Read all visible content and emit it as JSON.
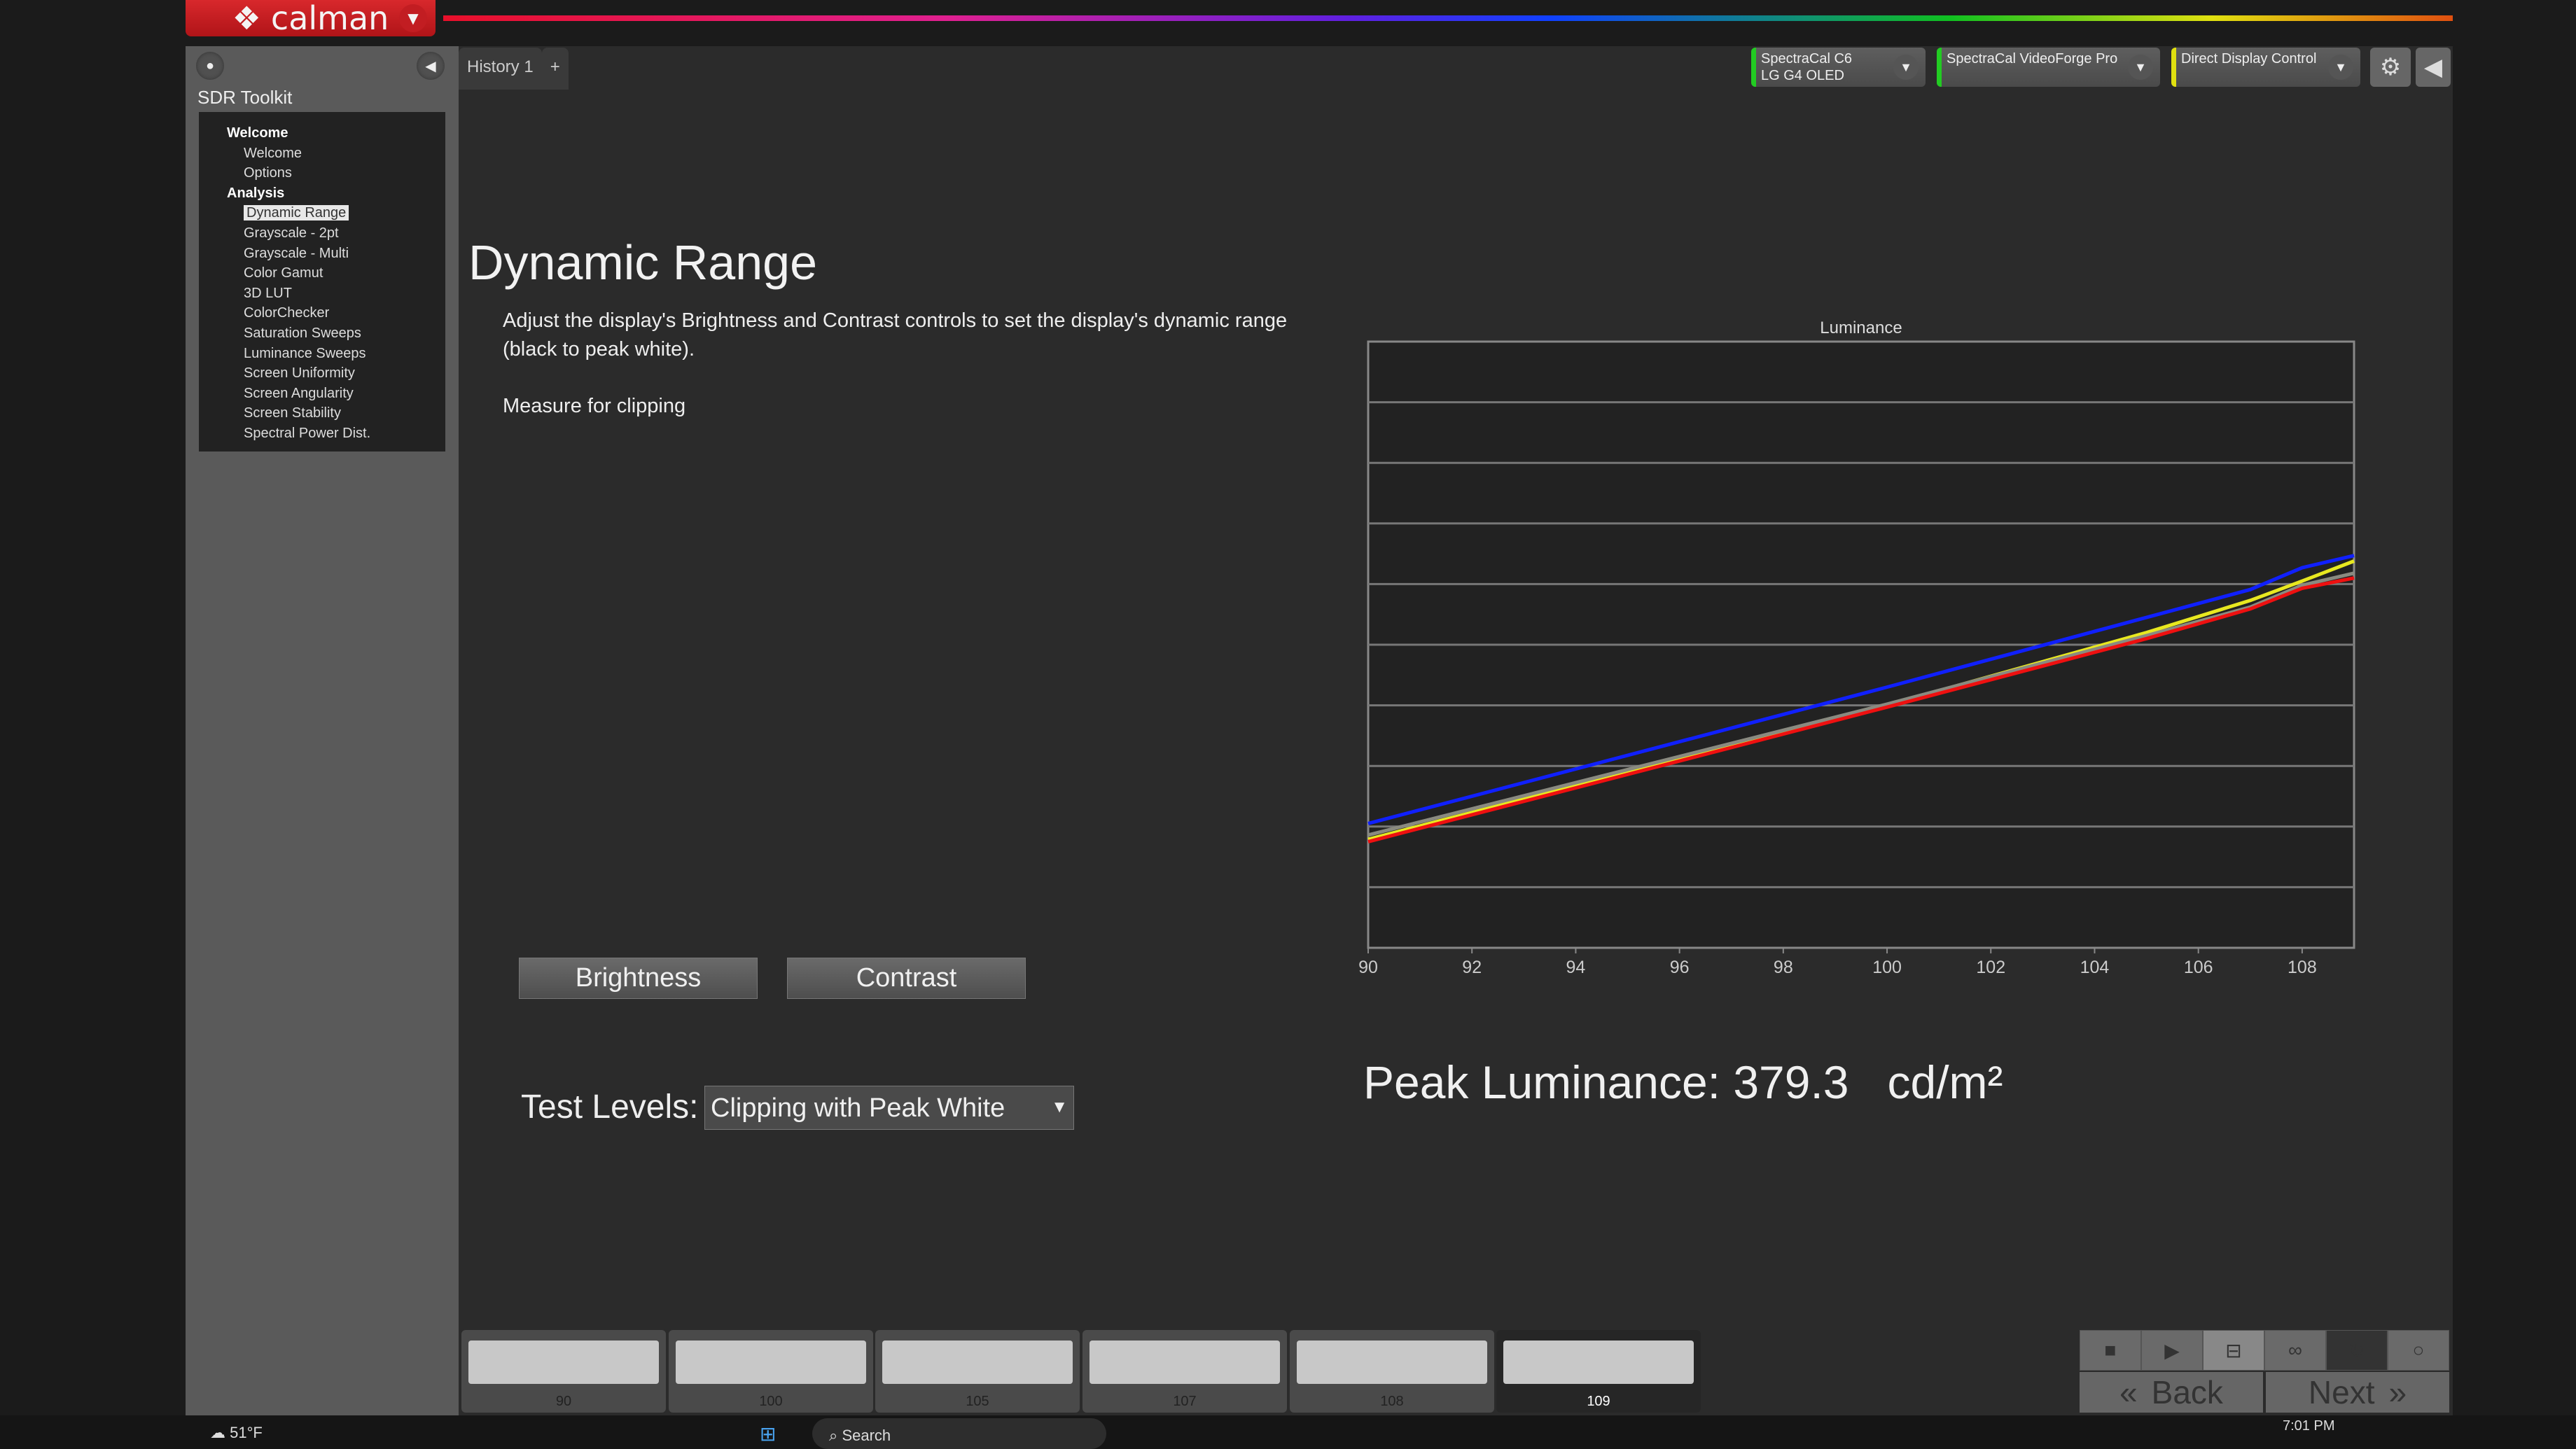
{
  "app": {
    "logo": "calman",
    "logo_icon": "calman-diamond-icon"
  },
  "sidebar": {
    "title": "SDR Toolkit",
    "tree": [
      {
        "label": "Welcome",
        "type": "group"
      },
      {
        "label": "Welcome",
        "type": "item"
      },
      {
        "label": "Options",
        "type": "item"
      },
      {
        "label": "Analysis",
        "type": "group"
      },
      {
        "label": "Dynamic Range",
        "type": "item",
        "selected": true
      },
      {
        "label": "Grayscale - 2pt",
        "type": "item"
      },
      {
        "label": "Grayscale - Multi",
        "type": "item"
      },
      {
        "label": "Color Gamut",
        "type": "item"
      },
      {
        "label": "3D LUT",
        "type": "item"
      },
      {
        "label": "ColorChecker",
        "type": "item"
      },
      {
        "label": "Saturation Sweeps",
        "type": "item"
      },
      {
        "label": "Luminance Sweeps",
        "type": "item"
      },
      {
        "label": "Screen Uniformity",
        "type": "item"
      },
      {
        "label": "Screen Angularity",
        "type": "item"
      },
      {
        "label": "Screen Stability",
        "type": "item"
      },
      {
        "label": "Spectral Power Dist.",
        "type": "item"
      }
    ]
  },
  "tabs": [
    {
      "label": "History 1"
    },
    {
      "label": "+"
    }
  ],
  "devices": [
    {
      "line1": "SpectraCal C6",
      "line2": "LG G4 OLED",
      "status": "#22cc22"
    },
    {
      "line1": "SpectraCal VideoForge Pro",
      "line2": "",
      "status": "#22cc22"
    },
    {
      "line1": "Direct Display Control",
      "line2": "",
      "status": "#e0e010"
    }
  ],
  "main": {
    "title": "Dynamic Range",
    "description": "Adjust the display's Brightness and Contrast controls to set the display's dynamic range (black to peak white).",
    "measure": "Measure for clipping",
    "brightness_label": "Brightness",
    "contrast_label": "Contrast",
    "test_levels_label": "Test Levels:",
    "test_levels_value": "Clipping with Peak White",
    "peak_label": "Peak Luminance: 379.3   cd/m²"
  },
  "chart_data": {
    "type": "line",
    "title": "Luminance",
    "xlim": [
      90,
      109
    ],
    "ylim": [
      0,
      10
    ],
    "grid": true,
    "y_ticks_shown": false,
    "x_ticks": [
      90,
      92,
      94,
      96,
      98,
      100,
      102,
      104,
      106,
      108
    ],
    "x": [
      90,
      100,
      105,
      107,
      108,
      109
    ],
    "series": [
      {
        "color": "#1020ff",
        "values": [
          2.05,
          4.3,
          5.45,
          5.91,
          6.27,
          6.47
        ]
      },
      {
        "color": "#e8e820",
        "values": [
          1.79,
          4.0,
          5.2,
          5.73,
          6.05,
          6.38
        ]
      },
      {
        "color": "#8a8a80",
        "values": [
          1.86,
          4.02,
          5.15,
          5.62,
          5.98,
          6.18
        ]
      },
      {
        "color": "#ee1010",
        "values": [
          1.75,
          3.97,
          5.1,
          5.59,
          5.93,
          6.1
        ]
      }
    ]
  },
  "patches": [
    {
      "label": "90"
    },
    {
      "label": "100"
    },
    {
      "label": "105"
    },
    {
      "label": "107"
    },
    {
      "label": "108"
    },
    {
      "label": "109",
      "active": true
    }
  ],
  "controls": {
    "back": "Back",
    "next": "Next"
  },
  "taskbar": {
    "weather": "51°F",
    "search": "Search",
    "time": "7:01 PM"
  }
}
